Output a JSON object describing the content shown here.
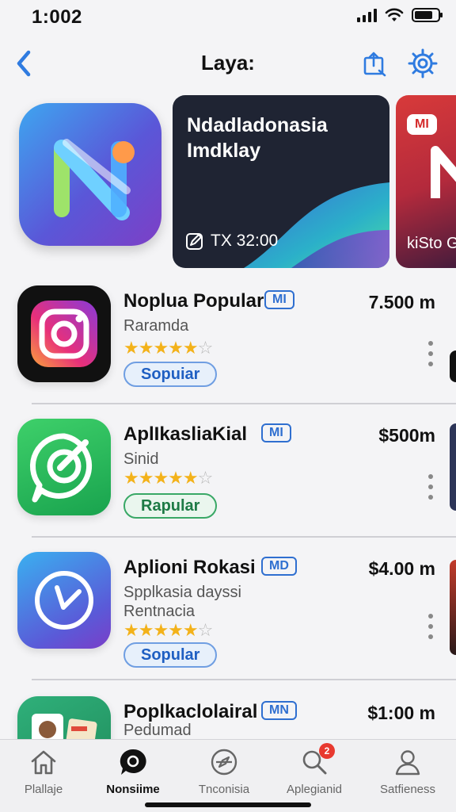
{
  "status_bar": {
    "time": "1:002"
  },
  "nav": {
    "title": "Laya:"
  },
  "featured": {
    "card_title": "Ndadladonasia Imdklay",
    "card_meta": "TX 32:00",
    "card2_badge": "MI",
    "card2_caption": "kiSto G"
  },
  "apps": [
    {
      "name": "Noplua Popular",
      "badge": "MI",
      "price": "7.500 m",
      "subtitle": "Raramda",
      "subtitle2": "",
      "rating": 4.5,
      "pill_label": "Sopuiar",
      "pill_style": "blue",
      "icon": "instagram-icon"
    },
    {
      "name": "AplIkasliaKial",
      "badge": "MI",
      "price": "$500m",
      "subtitle": "Sinid",
      "subtitle2": "",
      "rating": 4.5,
      "pill_label": "Rapular",
      "pill_style": "green",
      "icon": "check-chat-icon"
    },
    {
      "name": "Aplioni Rokasi",
      "badge": "MD",
      "price": "$4.00 m",
      "subtitle": "Spplkasia dayssi",
      "subtitle2": "Rentnacia",
      "rating": 4.8,
      "pill_label": "Sopular",
      "pill_style": "blue",
      "icon": "clock-icon"
    },
    {
      "name": "Poplkaclolairal",
      "badge": "MN",
      "price": "$1:00 m",
      "subtitle": "Pedumad",
      "subtitle2": "",
      "rating": 0,
      "pill_label": "",
      "pill_style": "blue",
      "icon": "person-photo-icon"
    }
  ],
  "tabs": [
    {
      "label": "Plallaje",
      "icon": "home-icon",
      "active": false
    },
    {
      "label": "Nonsiime",
      "icon": "chat-bubble-icon",
      "active": true
    },
    {
      "label": "Tnconisia",
      "icon": "compass-icon",
      "active": false
    },
    {
      "label": "Aplegianid",
      "icon": "search-icon",
      "active": false,
      "badge": "2"
    },
    {
      "label": "Satfieness",
      "icon": "person-icon",
      "active": false
    }
  ],
  "colors": {
    "accent": "#2f6fd0",
    "star": "#f3b21a",
    "badge_red": "#e8392f"
  }
}
